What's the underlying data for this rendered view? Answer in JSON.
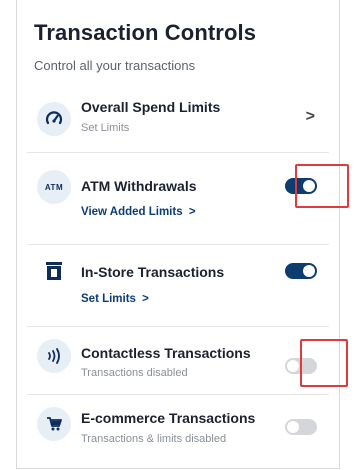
{
  "header": {
    "title": "Transaction Controls",
    "subtitle": "Control all your transactions"
  },
  "rows": [
    {
      "title": "Overall Spend Limits",
      "sub": "Set Limits",
      "icon": "speedometer-icon",
      "trailing": "chevron",
      "chevron": ">"
    },
    {
      "title": "ATM Withdrawals",
      "link": "View Added Limits",
      "link_chevron": ">",
      "icon": "atm-icon",
      "icon_text": "ATM",
      "trailing": "toggle",
      "enabled": true,
      "highlighted": true
    },
    {
      "title": "In-Store Transactions",
      "link": "Set Limits",
      "link_chevron": ">",
      "icon": "store-icon",
      "trailing": "toggle",
      "enabled": true,
      "highlighted": false
    },
    {
      "title": "Contactless Transactions",
      "sub": "Transactions disabled",
      "icon": "contactless-icon",
      "trailing": "toggle",
      "enabled": false,
      "highlighted": true
    },
    {
      "title": "E-commerce Transactions",
      "sub": "Transactions & limits disabled",
      "icon": "cart-icon",
      "trailing": "toggle",
      "enabled": false,
      "highlighted": false
    }
  ],
  "colors": {
    "toggle_on": "#0d3c6e",
    "toggle_off": "#d4d6da",
    "highlight": "#e0393e",
    "link": "#0b3c7a"
  }
}
